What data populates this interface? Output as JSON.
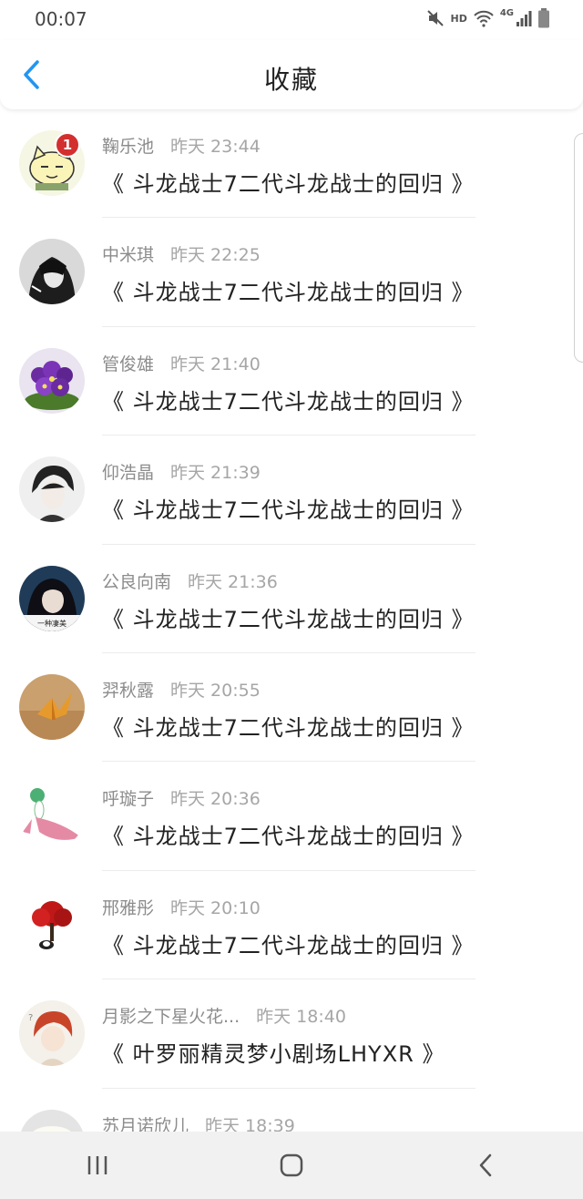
{
  "status_bar": {
    "time": "00:07",
    "hd_label": "HD",
    "network_label": "4G",
    "icons": [
      "mute-icon",
      "wifi-icon",
      "signal-icon",
      "battery-icon"
    ]
  },
  "header": {
    "title": "收藏",
    "back_icon": "chevron-left-icon",
    "accent_color": "#2196f3"
  },
  "favorites": [
    {
      "author": "鞠乐池",
      "time": "昨天 23:44",
      "title": "《 斗龙战士7二代斗龙战士的回归 》",
      "badge": "1",
      "avatar": "cartoon-cat"
    },
    {
      "author": "中米琪",
      "time": "昨天 22:25",
      "title": "《 斗龙战士7二代斗龙战士的回归 》",
      "avatar": "black-white-portrait"
    },
    {
      "author": "管俊雄",
      "time": "昨天 21:40",
      "title": "《 斗龙战士7二代斗龙战士的回归 》",
      "avatar": "purple-flowers"
    },
    {
      "author": "仰浩晶",
      "time": "昨天 21:39",
      "title": "《 斗龙战士7二代斗龙战士的回归 》",
      "avatar": "anime-boy"
    },
    {
      "author": "公良向南",
      "time": "昨天 21:36",
      "title": "《 斗龙战士7二代斗龙战士的回归 》",
      "avatar_caption": "一种凄美",
      "avatar": "dark-hair-girl"
    },
    {
      "author": "羿秋露",
      "time": "昨天 20:55",
      "title": "《 斗龙战士7二代斗龙战士的回归 》",
      "avatar": "paper-crane"
    },
    {
      "author": "呼璇子",
      "time": "昨天 20:36",
      "title": "《 斗龙战士7二代斗龙战士的回归 》",
      "avatar": "green-fairy"
    },
    {
      "author": "邢雅彤",
      "time": "昨天 20:10",
      "title": "《 斗龙战士7二代斗龙战士的回归 》",
      "avatar": "red-tree"
    },
    {
      "author": "月影之下星火花...",
      "time": "昨天 18:40",
      "title": "《 叶罗丽精灵梦小剧场LHYXR 》",
      "avatar": "red-hair-anime"
    },
    {
      "author": "苏月诺欣儿",
      "time": "昨天 18:39",
      "title": "",
      "avatar": "white-cake"
    }
  ],
  "nav_bar": {
    "icons": [
      "recent-apps-icon",
      "home-icon",
      "back-icon"
    ]
  }
}
